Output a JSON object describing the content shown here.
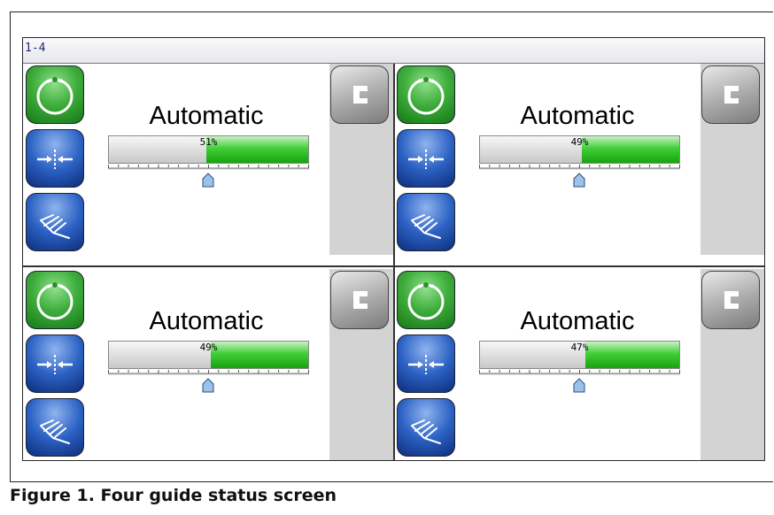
{
  "window": {
    "title": "1-4"
  },
  "caption": "Figure 1.  Four guide status screen",
  "guides": [
    {
      "mode": "Automatic",
      "percent_label": "51%",
      "percent": 51
    },
    {
      "mode": "Automatic",
      "percent_label": "49%",
      "percent": 49
    },
    {
      "mode": "Automatic",
      "percent_label": "49%",
      "percent": 49
    },
    {
      "mode": "Automatic",
      "percent_label": "47%",
      "percent": 47
    }
  ],
  "icons": {
    "automatic": "auto-cycle-icon",
    "center": "center-guide-icon",
    "manual": "manual-hand-icon",
    "top": "bracket-icon"
  },
  "colors": {
    "automatic_button": "#3fae3d",
    "blue_button": "#2c62c4",
    "bar_fill": "#41cf38",
    "title_text": "#1b2a7a"
  }
}
